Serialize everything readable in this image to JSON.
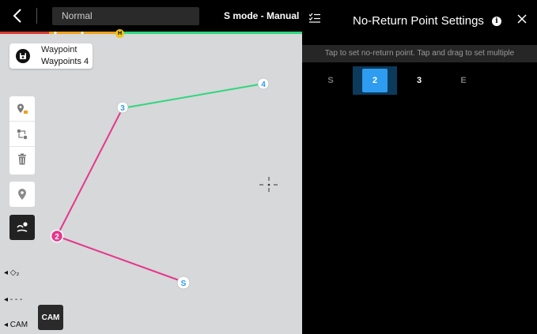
{
  "top_bar": {
    "mode_label": "Normal",
    "flight_mode": "S mode - Manual fli",
    "home_marker": "H"
  },
  "map": {
    "waypoint_card": {
      "title": "Waypoint",
      "count_label": "Waypoints 4"
    },
    "waypoint_markers": [
      "S",
      "2",
      "3",
      "4"
    ],
    "side_hints": [
      "◂ ◇₂",
      "◂ - - -",
      "◂ CAM"
    ],
    "cam_button": "CAM"
  },
  "panel": {
    "title": "No-Return Point Settings",
    "info_glyph": "i",
    "hint": "Tap to set no-return point. Tap and drag to set multiple",
    "points": [
      "S",
      "2",
      "3",
      "E"
    ],
    "selected_point": "2"
  },
  "colors": {
    "route_pink": "#e6368c",
    "route_green": "#2fd67e",
    "selected_blue": "#2e9cf0",
    "status_red": "#d83a2e",
    "status_orange": "#f0a01e",
    "status_green": "#2fd67e"
  }
}
